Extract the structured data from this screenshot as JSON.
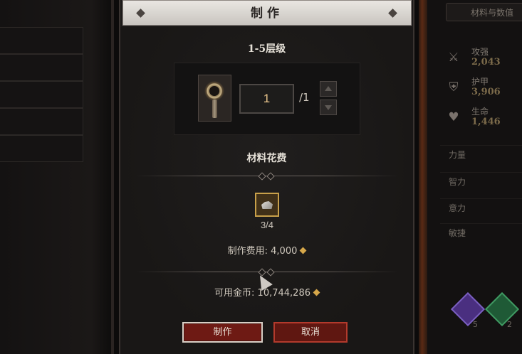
{
  "dialog": {
    "title": "制作",
    "tier_label": "1-5层级",
    "quantity_value": "1",
    "quantity_max": "/1",
    "materials_label": "材料花费",
    "material_count": "3/4",
    "craft_cost_label": "制作费用:",
    "craft_cost_value": "4,000",
    "available_gold_label": "可用金币:",
    "available_gold_value": "10,744,286",
    "craft_button": "制作",
    "cancel_button": "取消"
  },
  "right_panel": {
    "tab_label": "材料与数值",
    "stats": [
      {
        "name": "攻强",
        "value": "2,043",
        "icon": "swords-icon"
      },
      {
        "name": "护甲",
        "value": "3,906",
        "icon": "shield-icon"
      },
      {
        "name": "生命",
        "value": "1,446",
        "icon": "heart-icon"
      }
    ],
    "attributes": [
      "力量",
      "智力",
      "意力",
      "敏捷"
    ],
    "gems": [
      {
        "count": "5",
        "color": "#5a3a9a"
      },
      {
        "count": "2",
        "color": "#2d7a4a"
      }
    ]
  },
  "colors": {
    "accent_gold": "#d6a74a",
    "button_red": "#6e1a14",
    "title_bar": "#e9e6e2"
  }
}
